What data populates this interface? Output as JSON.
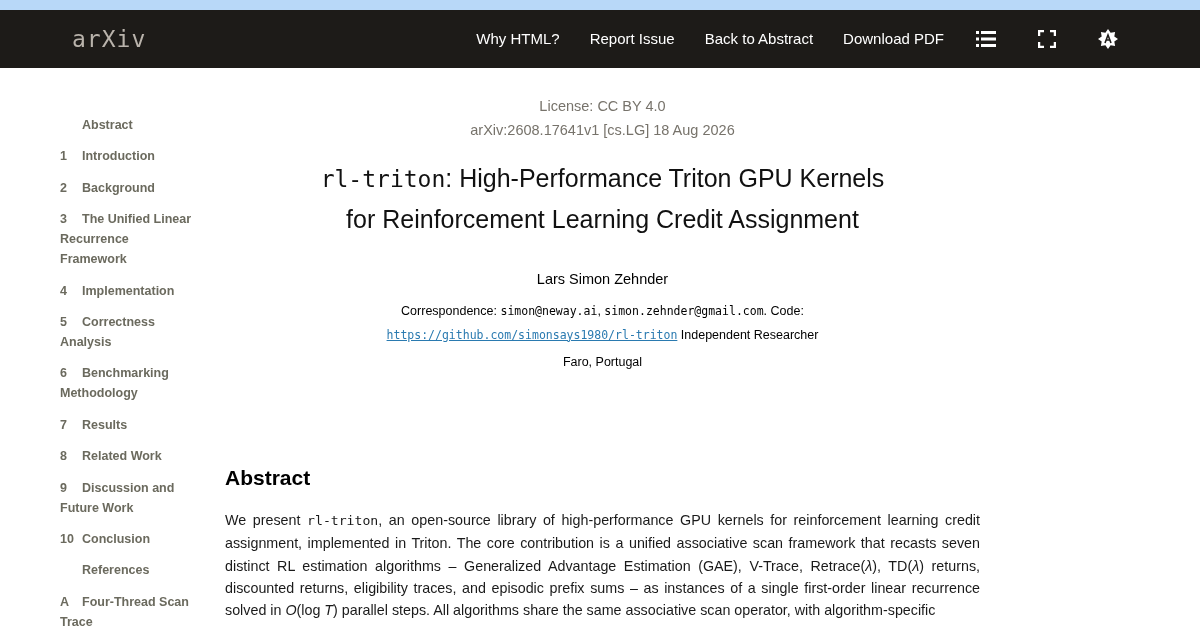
{
  "header": {
    "logo": "arXiv",
    "links": [
      "Why HTML?",
      "Report Issue",
      "Back to Abstract",
      "Download PDF"
    ]
  },
  "toc": [
    {
      "label": "Abstract"
    },
    {
      "number": "1",
      "label": "Introduction"
    },
    {
      "number": "2",
      "label": "Background"
    },
    {
      "number": "3",
      "label": "The Unified Linear Recurrence Framework"
    },
    {
      "number": "4",
      "label": "Implementation"
    },
    {
      "number": "5",
      "label": "Correctness Analysis"
    },
    {
      "number": "6",
      "label": "Benchmarking Methodology"
    },
    {
      "number": "7",
      "label": "Results"
    },
    {
      "number": "8",
      "label": "Related Work"
    },
    {
      "number": "9",
      "label": "Discussion and Future Work"
    },
    {
      "number": "10",
      "label": "Conclusion"
    },
    {
      "label": "References"
    },
    {
      "number": "A",
      "label": "Four-Thread Scan Trace"
    }
  ],
  "paper": {
    "license": "License: CC BY 4.0",
    "arxiv_id": "arXiv:2608.17641v1 [cs.LG] 18 Aug 2026",
    "title": [
      {
        "kind": "code",
        "text": "rl-triton"
      },
      {
        "kind": "text",
        "text": ": High-Performance Triton GPU Kernels for Reinforcement Learning Credit Assignment"
      }
    ],
    "author": "Lars Simon Zehnder",
    "correspondence": [
      {
        "kind": "text",
        "text": "Correspondence: "
      },
      {
        "kind": "code",
        "text": "simon@neway.ai"
      },
      {
        "kind": "text",
        "text": ", "
      },
      {
        "kind": "code",
        "text": "simon.zehnder@gmail.com"
      },
      {
        "kind": "text",
        "text": ". Code: "
      },
      {
        "kind": "link",
        "text": "https://github.com/simonsays1980/rl-triton"
      },
      {
        "kind": "text",
        "text": " Independent Researcher"
      }
    ],
    "location": "Faro, Portugal",
    "abstract_heading": "Abstract",
    "abstract": [
      {
        "kind": "text",
        "text": "We present "
      },
      {
        "kind": "code",
        "text": "rl-triton"
      },
      {
        "kind": "text",
        "text": ", an open-source library of high-performance GPU kernels for reinforcement learning credit assignment, implemented in Triton. The core contribution is a unified associative scan framework that recasts seven distinct RL estimation algorithms – Generalized Advantage Estimation (GAE), V-Trace, Retrace(*λ*), TD(*λ*) returns, discounted returns, eligibility traces, and episodic prefix sums – as instances of a single first-order linear recurrence solved in *O*(log *T*) parallel steps. All algorithms share the same associative scan operator, with algorithm-specific"
      }
    ]
  }
}
